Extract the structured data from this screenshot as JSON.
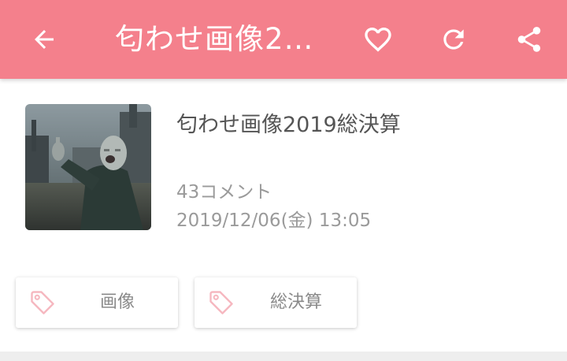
{
  "toolbar": {
    "title": "匂わせ画像20...",
    "back_icon": "arrow-left-icon",
    "favorite_icon": "heart-outline-icon",
    "reload_icon": "refresh-icon",
    "share_icon": "share-icon",
    "background": "#f4808c"
  },
  "article": {
    "title": "匂わせ画像2019総決算",
    "comments": "43コメント",
    "date": "2019/12/06(金) 13:05",
    "thumbnail_icon": "article-thumbnail"
  },
  "tags": [
    {
      "label": "画像",
      "icon": "tag-icon"
    },
    {
      "label": "総決算",
      "icon": "tag-icon"
    }
  ]
}
